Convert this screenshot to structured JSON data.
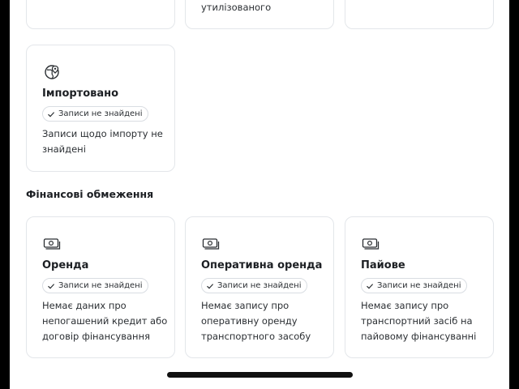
{
  "top_cards": {
    "middle_text": "утилізованого"
  },
  "imported_card": {
    "title": "Імпортовано",
    "badge": "Записи не знайдені",
    "description": "Записи щодо імпорту не знайдені",
    "icon": "globe-pin-icon"
  },
  "financial_section": {
    "title": "Фінансові обмеження",
    "cards": [
      {
        "title": "Оренда",
        "badge": "Записи не знайдені",
        "description": "Немає даних про непогашений кредит або договір фінансування",
        "icon": "money-icon"
      },
      {
        "title": "Оперативна оренда",
        "badge": "Записи не знайдені",
        "description": "Немає запису про оперативну оренду транспортного засобу",
        "icon": "money-icon"
      },
      {
        "title": "Пайове",
        "badge": "Записи не знайдені",
        "description": "Немає запису про транспортний засіб на пайовому фінансуванні",
        "icon": "money-icon"
      }
    ]
  },
  "colors": {
    "card_border": "#e3e6ea",
    "text": "#1c1f23",
    "frame": "#000000"
  }
}
